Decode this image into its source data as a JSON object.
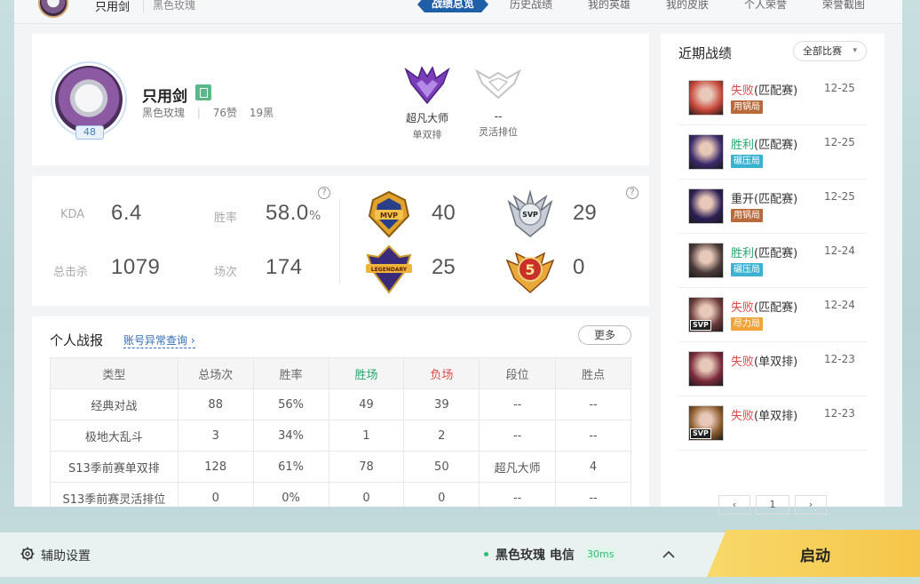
{
  "nav": {
    "name": "只用剑",
    "server": "黑色玫瑰",
    "tabs": [
      "战绩总览",
      "历史战绩",
      "我的英雄",
      "我的皮肤",
      "个人荣誉",
      "荣誉截图"
    ]
  },
  "profile": {
    "name": "只用剑",
    "server": "黑色玫瑰",
    "likes": "76赞",
    "blacks": "19黑",
    "level": "48",
    "ranks": [
      {
        "tier": "超凡大师",
        "queue": "单双排",
        "color": "#7a3fb8"
      },
      {
        "tier": "--",
        "queue": "灵活排位",
        "color": "#c8c8c8"
      }
    ]
  },
  "stats": {
    "kda_label": "KDA",
    "kda": "6.4",
    "winrate_label": "胜率",
    "winrate": "58.0",
    "winrate_unit": "%",
    "kills_label": "总击杀",
    "kills": "1079",
    "games_label": "场次",
    "games": "174",
    "help": "?",
    "medals": [
      {
        "icon": "mvp-medal-icon",
        "text": "MVP",
        "count": "40"
      },
      {
        "icon": "svp-medal-icon",
        "text": "SVP",
        "count": "29"
      },
      {
        "icon": "legendary-medal-icon",
        "text": "LEGENDARY",
        "count": "25"
      },
      {
        "icon": "pentakill-medal-icon",
        "text": "5",
        "count": "0"
      }
    ]
  },
  "report": {
    "title": "个人战报",
    "link": "账号异常查询",
    "more": "更多",
    "columns": [
      "类型",
      "总场次",
      "胜率",
      "胜场",
      "负场",
      "段位",
      "胜点"
    ],
    "rows": [
      [
        "经典对战",
        "88",
        "56%",
        "49",
        "39",
        "--",
        "--"
      ],
      [
        "极地大乱斗",
        "3",
        "34%",
        "1",
        "2",
        "--",
        "--"
      ],
      [
        "S13季前赛单双排",
        "128",
        "61%",
        "78",
        "50",
        "超凡大师",
        "4"
      ],
      [
        "S13季前赛灵活排位",
        "0",
        "0%",
        "0",
        "0",
        "--",
        "--"
      ]
    ]
  },
  "recent": {
    "title": "近期战绩",
    "filter": "全部比赛",
    "matches": [
      {
        "result": "失败",
        "mode": "(匹配赛)",
        "date": "12-25",
        "tag": "用锅局",
        "type": "lose",
        "tagcolor": "#b96a3a",
        "champ": "#c7463a",
        "svp": false
      },
      {
        "result": "胜利",
        "mode": "(匹配赛)",
        "date": "12-25",
        "tag": "碾压局",
        "type": "win",
        "tagcolor": "#3bb3d0",
        "champ": "#3a2a6a",
        "svp": false
      },
      {
        "result": "重开",
        "mode": "(匹配赛)",
        "date": "12-25",
        "tag": "用锅局",
        "type": "draw",
        "tagcolor": "#b96a3a",
        "champ": "#2c1f55",
        "svp": false
      },
      {
        "result": "胜利",
        "mode": "(匹配赛)",
        "date": "12-24",
        "tag": "碾压局",
        "type": "win",
        "tagcolor": "#3bb3d0",
        "champ": "#4a3a3a",
        "svp": false
      },
      {
        "result": "失败",
        "mode": "(匹配赛)",
        "date": "12-24",
        "tag": "尽力局",
        "type": "lose",
        "tagcolor": "#f0a43a",
        "champ": "#6a3a3a",
        "svp": true
      },
      {
        "result": "失败",
        "mode": "(单双排)",
        "date": "12-23",
        "tag": "",
        "type": "lose",
        "tagcolor": "",
        "champ": "#7a2a3a",
        "svp": false
      },
      {
        "result": "失败",
        "mode": "(单双排)",
        "date": "12-23",
        "tag": "",
        "type": "lose",
        "tagcolor": "",
        "champ": "#8a5a2a",
        "svp": true
      }
    ],
    "svp_label": "SVP",
    "page": "1"
  },
  "bottom": {
    "assist": "辅助设置",
    "server": "黑色玫瑰 电信",
    "ping": "30ms",
    "start": "启动"
  }
}
